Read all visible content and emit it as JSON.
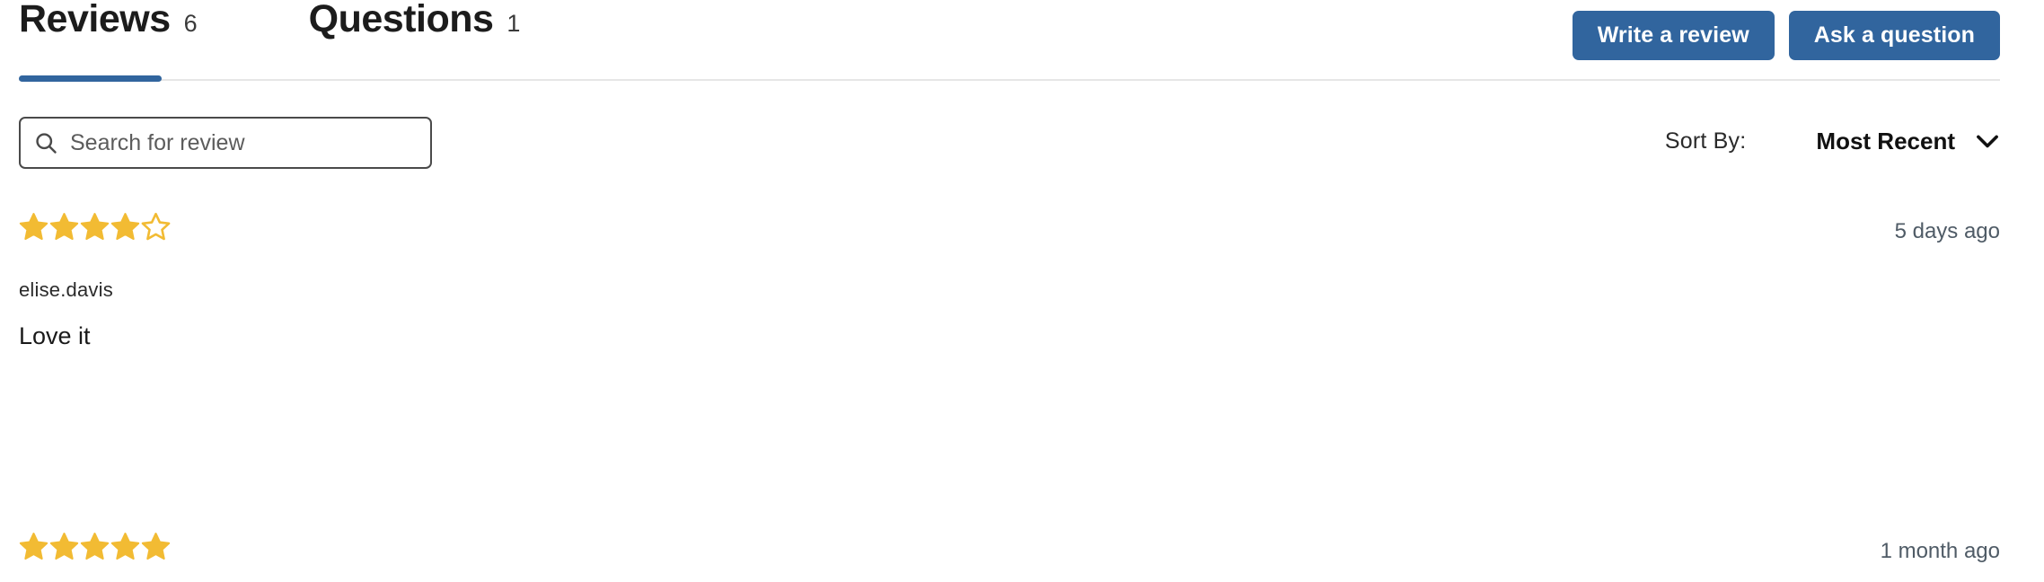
{
  "theme": {
    "accent_blue": "#31659e",
    "star_gold": "#f2bb33",
    "divider_gray": "#e6e6e6",
    "text_dark": "#1a1a1a"
  },
  "tabs": [
    {
      "label": "Reviews",
      "count": "6",
      "active": true
    },
    {
      "label": "Questions",
      "count": "1",
      "active": false
    }
  ],
  "header": {
    "write_review_label": "Write a review",
    "ask_question_label": "Ask a question"
  },
  "search": {
    "placeholder": "Search for review",
    "value": "",
    "icon": "search-icon"
  },
  "sort": {
    "label": "Sort By:",
    "value": "Most Recent",
    "icon": "chevron-down-icon"
  },
  "reviews": [
    {
      "rating": 4,
      "max_rating": 5,
      "age": "5 days ago",
      "author": "elise.davis",
      "body": "Love it"
    },
    {
      "rating": 5,
      "max_rating": 5,
      "age": "1 month ago",
      "author": "",
      "body": ""
    }
  ]
}
